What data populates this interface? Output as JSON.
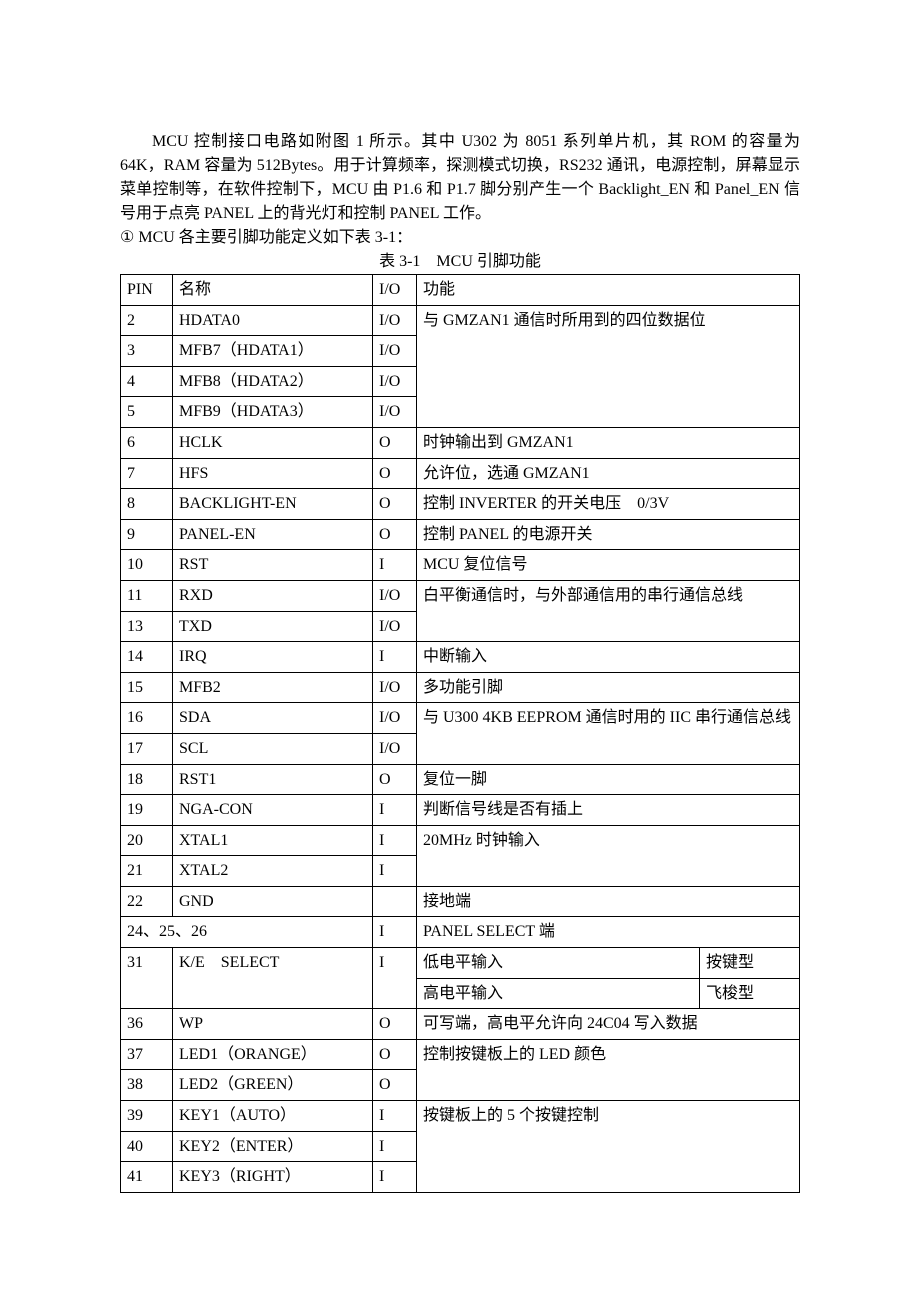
{
  "intro": {
    "p1": "MCU 控制接口电路如附图 1 所示。其中 U302 为 8051 系列单片机，其 ROM 的容量为 64K，RAM 容量为 512Bytes。用于计算频率，探测模式切换，RS232 通讯，电源控制，屏幕显示菜单控制等，在软件控制下，MCU 由 P1.6 和 P1.7 脚分别产生一个 Backlight_EN 和 Panel_EN 信号用于点亮 PANEL 上的背光灯和控制 PANEL 工作。",
    "p2": "① MCU 各主要引脚功能定义如下表 3-1：",
    "caption": "表 3-1　MCU 引脚功能"
  },
  "headers": {
    "pin": "PIN",
    "name": "名称",
    "io": "I/O",
    "func": "功能"
  },
  "rows": {
    "r2": {
      "pin": "2",
      "name": "HDATA0",
      "io": "I/O",
      "func": "与 GMZAN1 通信时所用到的四位数据位"
    },
    "r3": {
      "pin": "3",
      "name": "MFB7（HDATA1）",
      "io": "I/O"
    },
    "r4": {
      "pin": "4",
      "name": "MFB8（HDATA2）",
      "io": "I/O"
    },
    "r5": {
      "pin": "5",
      "name": "MFB9（HDATA3）",
      "io": "I/O"
    },
    "r6": {
      "pin": "6",
      "name": "HCLK",
      "io": "O",
      "func": "时钟输出到 GMZAN1"
    },
    "r7": {
      "pin": "7",
      "name": "HFS",
      "io": "O",
      "func": "允许位，选通 GMZAN1"
    },
    "r8": {
      "pin": "8",
      "name": "BACKLIGHT-EN",
      "io": "O",
      "func": "控制 INVERTER 的开关电压　0/3V"
    },
    "r9": {
      "pin": "9",
      "name": "PANEL-EN",
      "io": "O",
      "func": "控制 PANEL 的电源开关"
    },
    "r10": {
      "pin": "10",
      "name": "RST",
      "io": "I",
      "func": "MCU 复位信号"
    },
    "r11": {
      "pin": "11",
      "name": "RXD",
      "io": "I/O",
      "func": "白平衡通信时，与外部通信用的串行通信总线"
    },
    "r13": {
      "pin": "13",
      "name": "TXD",
      "io": "I/O"
    },
    "r14": {
      "pin": "14",
      "name": "IRQ",
      "io": "I",
      "func": "中断输入"
    },
    "r15": {
      "pin": "15",
      "name": "MFB2",
      "io": "I/O",
      "func": "多功能引脚"
    },
    "r16": {
      "pin": "16",
      "name": "SDA",
      "io": "I/O",
      "func": "与 U300 4KB EEPROM 通信时用的 IIC 串行通信总线"
    },
    "r17": {
      "pin": "17",
      "name": "SCL",
      "io": "I/O"
    },
    "r18": {
      "pin": "18",
      "name": "RST1",
      "io": "O",
      "func": "复位一脚"
    },
    "r19": {
      "pin": "19",
      "name": "NGA-CON",
      "io": "I",
      "func": "判断信号线是否有插上"
    },
    "r20": {
      "pin": "20",
      "name": "XTAL1",
      "io": "I",
      "func": "20MHz 时钟输入"
    },
    "r21": {
      "pin": "21",
      "name": "XTAL2",
      "io": "I"
    },
    "r22": {
      "pin": "22",
      "name": "GND",
      "io": "",
      "func": "接地端"
    },
    "r24": {
      "pin": "24、25、26",
      "io": "I",
      "func": "PANEL SELECT 端"
    },
    "r31": {
      "pin": "31",
      "name": "K/E　SELECT",
      "io": "I",
      "f1": "低电平输入",
      "t1": "按键型",
      "f2": "高电平输入",
      "t2": "飞梭型"
    },
    "r36": {
      "pin": "36",
      "name": "WP",
      "io": "O",
      "func": "可写端，高电平允许向 24C04 写入数据"
    },
    "r37": {
      "pin": "37",
      "name": "LED1（ORANGE）",
      "io": "O",
      "func": "控制按键板上的 LED 颜色"
    },
    "r38": {
      "pin": "38",
      "name": "LED2（GREEN）",
      "io": "O"
    },
    "r39": {
      "pin": "39",
      "name": "KEY1（AUTO）",
      "io": "I",
      "func": "按键板上的 5 个按键控制"
    },
    "r40": {
      "pin": "40",
      "name": "KEY2（ENTER）",
      "io": "I"
    },
    "r41": {
      "pin": "41",
      "name": "KEY3（RIGHT）",
      "io": "I"
    }
  }
}
